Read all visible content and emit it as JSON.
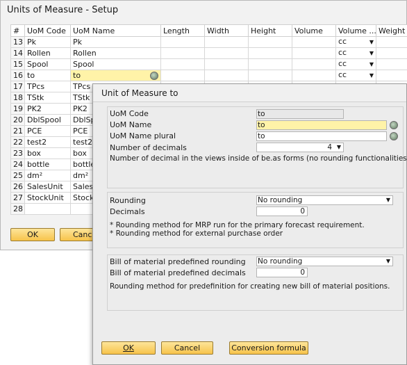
{
  "setup_window": {
    "title": "Units of Measure - Setup",
    "columns": [
      "#",
      "UoM Code",
      "UoM Name",
      "Length",
      "Width",
      "Height",
      "Volume",
      "Volume ...",
      "Weight"
    ],
    "rows": [
      {
        "num": "13",
        "code": "Pk",
        "name": "Pk",
        "volume_unit": "cc"
      },
      {
        "num": "14",
        "code": "Rollen",
        "name": "Rollen",
        "volume_unit": "cc"
      },
      {
        "num": "15",
        "code": "Spool",
        "name": "Spool",
        "volume_unit": "cc"
      },
      {
        "num": "16",
        "code": "to",
        "name": "to",
        "volume_unit": "cc"
      },
      {
        "num": "17",
        "code": "TPcs",
        "name": "TPcs",
        "volume_unit": ""
      },
      {
        "num": "18",
        "code": "TStk",
        "name": "TStk",
        "volume_unit": ""
      },
      {
        "num": "19",
        "code": "PK2",
        "name": "PK2",
        "volume_unit": ""
      },
      {
        "num": "20",
        "code": "DblSpool",
        "name": "DblSpo",
        "volume_unit": ""
      },
      {
        "num": "21",
        "code": "PCE",
        "name": "PCE",
        "volume_unit": ""
      },
      {
        "num": "22",
        "code": "test2",
        "name": "test2",
        "volume_unit": ""
      },
      {
        "num": "23",
        "code": "box",
        "name": "box",
        "volume_unit": ""
      },
      {
        "num": "24",
        "code": "bottle",
        "name": "bottle",
        "volume_unit": ""
      },
      {
        "num": "25",
        "code": "dm²",
        "name": "dm²",
        "volume_unit": ""
      },
      {
        "num": "26",
        "code": "SalesUnit",
        "name": "SalesUn",
        "volume_unit": ""
      },
      {
        "num": "27",
        "code": "StockUnit",
        "name": "StockUn",
        "volume_unit": ""
      },
      {
        "num": "28",
        "code": "",
        "name": "",
        "volume_unit": ""
      }
    ],
    "ok_label": "OK",
    "cancel_label": "Cance"
  },
  "dialog": {
    "title": "Unit of Measure to",
    "uom_code_label": "UoM Code",
    "uom_code_value": "to",
    "uom_name_label": "UoM Name",
    "uom_name_value": "to",
    "uom_name_plural_label": "UoM Name plural",
    "uom_name_plural_value": "to",
    "decimals_count_label": "Number of decimals",
    "decimals_count_value": "4",
    "decimals_note": "Number of decimal in the views inside of be.as forms (no rounding functionalities)",
    "rounding_label": "Rounding",
    "rounding_value": "No rounding",
    "rounding_decimals_label": "Decimals",
    "rounding_decimals_value": "0",
    "rounding_note_1": "* Rounding method for MRP run for the primary forecast requirement.",
    "rounding_note_2": "* Rounding method for external purchase order",
    "bom_rounding_label": "Bill of material predefined rounding",
    "bom_rounding_value": "No rounding",
    "bom_decimals_label": "Bill of material predefined decimals",
    "bom_decimals_value": "0",
    "bom_note": "Rounding method for predefinition for creating new bill of material positions.",
    "ok_label": "OK",
    "cancel_label": "Cancel",
    "conversion_label": "Conversion formula"
  }
}
